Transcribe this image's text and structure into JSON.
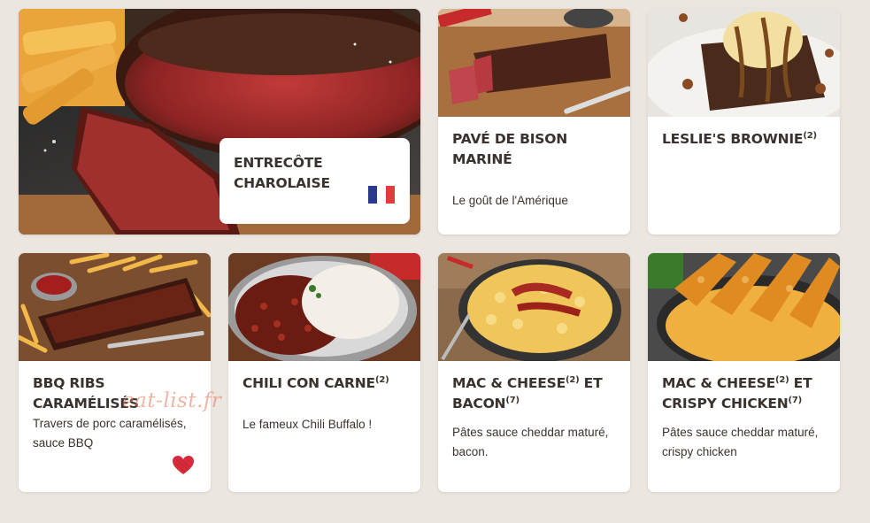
{
  "colors": {
    "background": "#ebe6df",
    "text": "#3a322e",
    "card": "#ffffff",
    "heart": "#d62b3a"
  },
  "hero": {
    "title": "ENTRECÔTE CHAROLAISE",
    "flag": [
      "#2b3a8c",
      "#ffffff",
      "#e23b3b"
    ]
  },
  "cards": [
    {
      "title": "PAVÉ DE BISON MARINÉ",
      "sup": "",
      "desc": "Le goût de l'Amérique"
    },
    {
      "title": "LESLIE'S BROWNIE",
      "sup": "(2)",
      "desc": ""
    },
    {
      "title": "BBQ RIBS CARAMÉLISÉS",
      "sup": "",
      "desc": "Travers de porc caramélisés, sauce BBQ"
    },
    {
      "title": "CHILI CON CARNE",
      "sup": "(2)",
      "desc": "Le fameux Chili Buffalo !"
    },
    {
      "title_a": "MAC & CHEESE",
      "sup_a": "(2)",
      "title_b": " ET BACON",
      "sup_b": "(7)",
      "desc": "Pâtes sauce cheddar maturé, bacon."
    },
    {
      "title_a": "MAC & CHEESE",
      "sup_a": "(2)",
      "title_b": " ET CRISPY CHICKEN",
      "sup_b": "(7)",
      "desc": "Pâtes sauce cheddar maturé, crispy chicken"
    }
  ],
  "watermark": "eat-list.fr",
  "icons": {
    "flag": "france-flag-icon",
    "heart": "heart-icon"
  }
}
